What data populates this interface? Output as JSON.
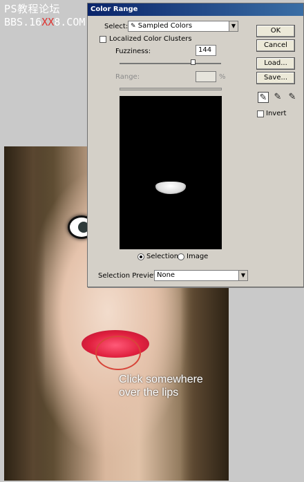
{
  "watermark": {
    "line1": "PS教程论坛",
    "line2_prefix": "BBS.16",
    "line2_red": "XX",
    "line2_suffix": "8.COM"
  },
  "photo": {
    "hint_line1": "Click somewhere",
    "hint_line2": "over the lips"
  },
  "dialog": {
    "title": "Color Range",
    "select_label": "Select:",
    "select_value": "Sampled Colors",
    "localized_label": "Localized Color Clusters",
    "fuzziness_label": "Fuzziness:",
    "fuzziness_value": "144",
    "range_label": "Range:",
    "range_value": "",
    "range_unit": "%",
    "selection_label": "Selection",
    "image_label": "Image",
    "preview_label": "Selection Preview:",
    "preview_value": "None",
    "ok": "OK",
    "cancel": "Cancel",
    "load": "Load...",
    "save": "Save...",
    "invert_label": "Invert",
    "fuzziness_fraction": 0.72
  }
}
